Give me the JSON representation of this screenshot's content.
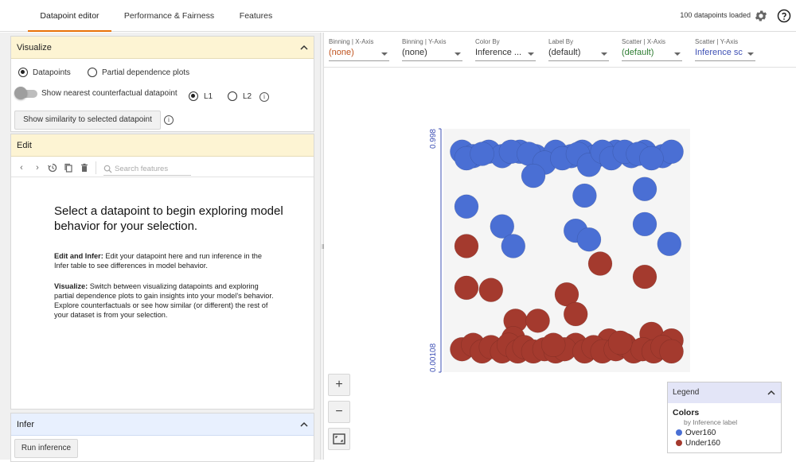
{
  "tabs": [
    {
      "label": "Datapoint editor"
    },
    {
      "label": "Performance & Fairness"
    },
    {
      "label": "Features"
    }
  ],
  "header": {
    "status": "100 datapoints loaded",
    "settings_icon": "gear-icon",
    "help_icon": "help-icon"
  },
  "visualize": {
    "title": "Visualize",
    "mode_datapoints": "Datapoints",
    "mode_pdp": "Partial dependence plots",
    "selected_mode": "Datapoints",
    "counterfactual_label": "Show nearest counterfactual datapoint",
    "counterfactual_on": false,
    "l1": "L1",
    "l2": "L2",
    "selected_distance": "L1",
    "similarity_button": "Show similarity to selected datapoint"
  },
  "edit": {
    "title": "Edit",
    "search_placeholder": "Search features",
    "message": "Select a datapoint to begin exploring model behavior for your selection.",
    "edit_infer_bold": "Edit and Infer:",
    "edit_infer_text": "Edit your datapoint here and run inference in the Infer table to see differences in model behavior.",
    "visualize_bold": "Visualize:",
    "visualize_text": "Switch between visualizing datapoints and exploring partial dependence plots to gain insights into your model's behavior. Explore counterfactuals or see how similar (or different) the rest of your dataset is from your selection."
  },
  "infer": {
    "title": "Infer",
    "run_button": "Run inference"
  },
  "controls": [
    {
      "label": "Binning | X-Axis",
      "value": "(none)",
      "color": "#c0531e"
    },
    {
      "label": "Binning | Y-Axis",
      "value": "(none)",
      "color": "#333333"
    },
    {
      "label": "Color By",
      "value": "Inference ...",
      "color": "#333333"
    },
    {
      "label": "Label By",
      "value": "(default)",
      "color": "#333333"
    },
    {
      "label": "Scatter | X-Axis",
      "value": "(default)",
      "color": "#2e7d32"
    },
    {
      "label": "Scatter | Y-Axis",
      "value": "Inference sc",
      "color": "#3f51b5"
    }
  ],
  "chart_data": {
    "type": "scatter",
    "ylabel_top": "0.998",
    "ylabel_bottom": "0.00108",
    "ylim": [
      0.00108,
      0.998
    ],
    "xlim": [
      0,
      1
    ],
    "colors": {
      "Over160": "#4a6fd4",
      "Under160": "#a43a2e"
    },
    "points": [
      {
        "x": 0.03,
        "y": 0.95,
        "c": "Over160"
      },
      {
        "x": 0.08,
        "y": 0.93,
        "c": "Over160"
      },
      {
        "x": 0.15,
        "y": 0.95,
        "c": "Over160"
      },
      {
        "x": 0.21,
        "y": 0.93,
        "c": "Over160"
      },
      {
        "x": 0.29,
        "y": 0.95,
        "c": "Over160"
      },
      {
        "x": 0.36,
        "y": 0.93,
        "c": "Over160"
      },
      {
        "x": 0.45,
        "y": 0.95,
        "c": "Over160"
      },
      {
        "x": 0.52,
        "y": 0.93,
        "c": "Over160"
      },
      {
        "x": 0.57,
        "y": 0.95,
        "c": "Over160"
      },
      {
        "x": 0.63,
        "y": 0.93,
        "c": "Over160"
      },
      {
        "x": 0.72,
        "y": 0.95,
        "c": "Over160"
      },
      {
        "x": 0.79,
        "y": 0.93,
        "c": "Over160"
      },
      {
        "x": 0.85,
        "y": 0.95,
        "c": "Over160"
      },
      {
        "x": 0.93,
        "y": 0.93,
        "c": "Over160"
      },
      {
        "x": 0.97,
        "y": 0.95,
        "c": "Over160"
      },
      {
        "x": 0.05,
        "y": 0.92,
        "c": "Over160"
      },
      {
        "x": 0.12,
        "y": 0.94,
        "c": "Over160"
      },
      {
        "x": 0.25,
        "y": 0.95,
        "c": "Over160"
      },
      {
        "x": 0.33,
        "y": 0.94,
        "c": "Over160"
      },
      {
        "x": 0.4,
        "y": 0.9,
        "c": "Over160"
      },
      {
        "x": 0.48,
        "y": 0.92,
        "c": "Over160"
      },
      {
        "x": 0.55,
        "y": 0.94,
        "c": "Over160"
      },
      {
        "x": 0.6,
        "y": 0.89,
        "c": "Over160"
      },
      {
        "x": 0.66,
        "y": 0.95,
        "c": "Over160"
      },
      {
        "x": 0.7,
        "y": 0.92,
        "c": "Over160"
      },
      {
        "x": 0.76,
        "y": 0.95,
        "c": "Over160"
      },
      {
        "x": 0.82,
        "y": 0.94,
        "c": "Over160"
      },
      {
        "x": 0.88,
        "y": 0.92,
        "c": "Over160"
      },
      {
        "x": 0.35,
        "y": 0.84,
        "c": "Over160"
      },
      {
        "x": 0.85,
        "y": 0.78,
        "c": "Over160"
      },
      {
        "x": 0.58,
        "y": 0.75,
        "c": "Over160"
      },
      {
        "x": 0.05,
        "y": 0.7,
        "c": "Over160"
      },
      {
        "x": 0.21,
        "y": 0.61,
        "c": "Over160"
      },
      {
        "x": 0.54,
        "y": 0.59,
        "c": "Over160"
      },
      {
        "x": 0.85,
        "y": 0.62,
        "c": "Over160"
      },
      {
        "x": 0.6,
        "y": 0.55,
        "c": "Over160"
      },
      {
        "x": 0.26,
        "y": 0.52,
        "c": "Over160"
      },
      {
        "x": 0.96,
        "y": 0.53,
        "c": "Over160"
      },
      {
        "x": 0.05,
        "y": 0.52,
        "c": "Under160"
      },
      {
        "x": 0.65,
        "y": 0.44,
        "c": "Under160"
      },
      {
        "x": 0.85,
        "y": 0.38,
        "c": "Under160"
      },
      {
        "x": 0.05,
        "y": 0.33,
        "c": "Under160"
      },
      {
        "x": 0.16,
        "y": 0.32,
        "c": "Under160"
      },
      {
        "x": 0.5,
        "y": 0.3,
        "c": "Under160"
      },
      {
        "x": 0.54,
        "y": 0.21,
        "c": "Under160"
      },
      {
        "x": 0.27,
        "y": 0.18,
        "c": "Under160"
      },
      {
        "x": 0.37,
        "y": 0.18,
        "c": "Under160"
      },
      {
        "x": 0.26,
        "y": 0.1,
        "c": "Under160"
      },
      {
        "x": 0.54,
        "y": 0.07,
        "c": "Under160"
      },
      {
        "x": 0.69,
        "y": 0.09,
        "c": "Under160"
      },
      {
        "x": 0.88,
        "y": 0.12,
        "c": "Under160"
      },
      {
        "x": 0.97,
        "y": 0.09,
        "c": "Under160"
      },
      {
        "x": 0.03,
        "y": 0.05,
        "c": "Under160"
      },
      {
        "x": 0.08,
        "y": 0.07,
        "c": "Under160"
      },
      {
        "x": 0.12,
        "y": 0.04,
        "c": "Under160"
      },
      {
        "x": 0.16,
        "y": 0.06,
        "c": "Under160"
      },
      {
        "x": 0.21,
        "y": 0.04,
        "c": "Under160"
      },
      {
        "x": 0.24,
        "y": 0.07,
        "c": "Under160"
      },
      {
        "x": 0.28,
        "y": 0.04,
        "c": "Under160"
      },
      {
        "x": 0.31,
        "y": 0.06,
        "c": "Under160"
      },
      {
        "x": 0.35,
        "y": 0.04,
        "c": "Under160"
      },
      {
        "x": 0.4,
        "y": 0.05,
        "c": "Under160"
      },
      {
        "x": 0.45,
        "y": 0.04,
        "c": "Under160"
      },
      {
        "x": 0.49,
        "y": 0.05,
        "c": "Under160"
      },
      {
        "x": 0.58,
        "y": 0.04,
        "c": "Under160"
      },
      {
        "x": 0.62,
        "y": 0.06,
        "c": "Under160"
      },
      {
        "x": 0.66,
        "y": 0.04,
        "c": "Under160"
      },
      {
        "x": 0.72,
        "y": 0.05,
        "c": "Under160"
      },
      {
        "x": 0.76,
        "y": 0.07,
        "c": "Under160"
      },
      {
        "x": 0.8,
        "y": 0.04,
        "c": "Under160"
      },
      {
        "x": 0.84,
        "y": 0.05,
        "c": "Under160"
      },
      {
        "x": 0.89,
        "y": 0.04,
        "c": "Under160"
      },
      {
        "x": 0.93,
        "y": 0.06,
        "c": "Under160"
      },
      {
        "x": 0.97,
        "y": 0.04,
        "c": "Under160"
      },
      {
        "x": 0.44,
        "y": 0.07,
        "c": "Under160"
      },
      {
        "x": 0.74,
        "y": 0.08,
        "c": "Under160"
      }
    ]
  },
  "legend": {
    "header": "Legend",
    "title": "Colors",
    "subtitle": "by Inference label",
    "items": [
      {
        "label": "Over160",
        "color": "#4a6fd4"
      },
      {
        "label": "Under160",
        "color": "#a43a2e"
      }
    ]
  },
  "zoom": {
    "in": "+",
    "out": "−"
  }
}
